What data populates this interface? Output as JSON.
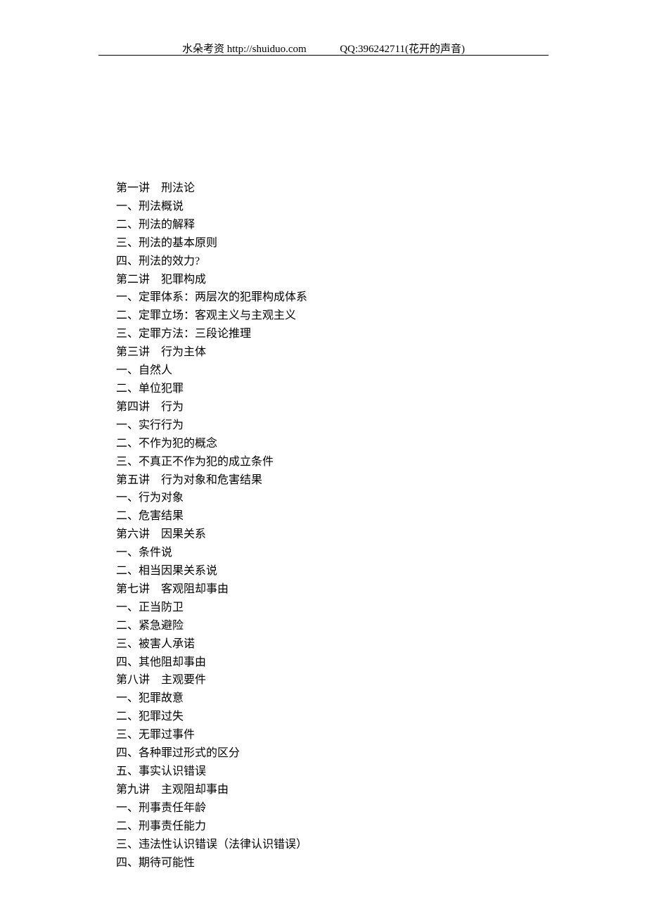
{
  "header": {
    "left": "水朵考资  http://shuiduo.com",
    "right": "QQ:396242711(花开的声音)"
  },
  "lines": [
    "第一讲　刑法论",
    "一、刑法概说",
    "二、刑法的解释",
    "三、刑法的基本原则",
    "四、刑法的效力?",
    "第二讲　犯罪构成",
    "一、定罪体系：两层次的犯罪构成体系",
    "二、定罪立场：客观主义与主观主义",
    "三、定罪方法：三段论推理",
    "第三讲　行为主体",
    "一、自然人",
    "二、单位犯罪",
    "第四讲　行为",
    "一、实行行为",
    "二、不作为犯的概念",
    "三、不真正不作为犯的成立条件",
    "第五讲　行为对象和危害结果",
    "一、行为对象",
    "二、危害结果",
    "第六讲　因果关系",
    "一、条件说",
    "二、相当因果关系说",
    "第七讲　客观阻却事由",
    "一、正当防卫",
    "二、紧急避险",
    "三、被害人承诺",
    "四、其他阻却事由",
    "第八讲　主观要件",
    "一、犯罪故意",
    "二、犯罪过失",
    "三、无罪过事件",
    "四、各种罪过形式的区分",
    "五、事实认识错误",
    "第九讲　主观阻却事由",
    "一、刑事责任年龄",
    "二、刑事责任能力",
    "三、违法性认识错误（法律认识错误）",
    "四、期待可能性"
  ]
}
